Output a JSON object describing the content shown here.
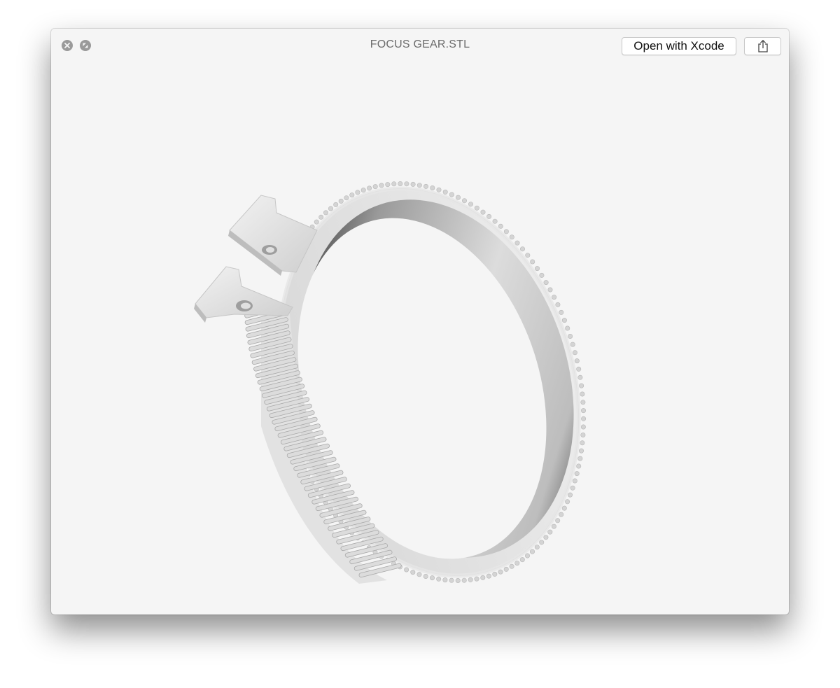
{
  "window": {
    "title": "FOCUS GEAR.STL"
  },
  "toolbar": {
    "close_icon": "close-icon",
    "fullscreen_icon": "fullscreen-icon",
    "open_label": "Open with Xcode",
    "share_icon": "share-icon"
  },
  "preview": {
    "model": "focus gear ring with two clamp tabs",
    "colors": {
      "background": "#f5f5f5",
      "model_light": "#e8e8e8",
      "model_dark": "#1a1a1a"
    }
  }
}
